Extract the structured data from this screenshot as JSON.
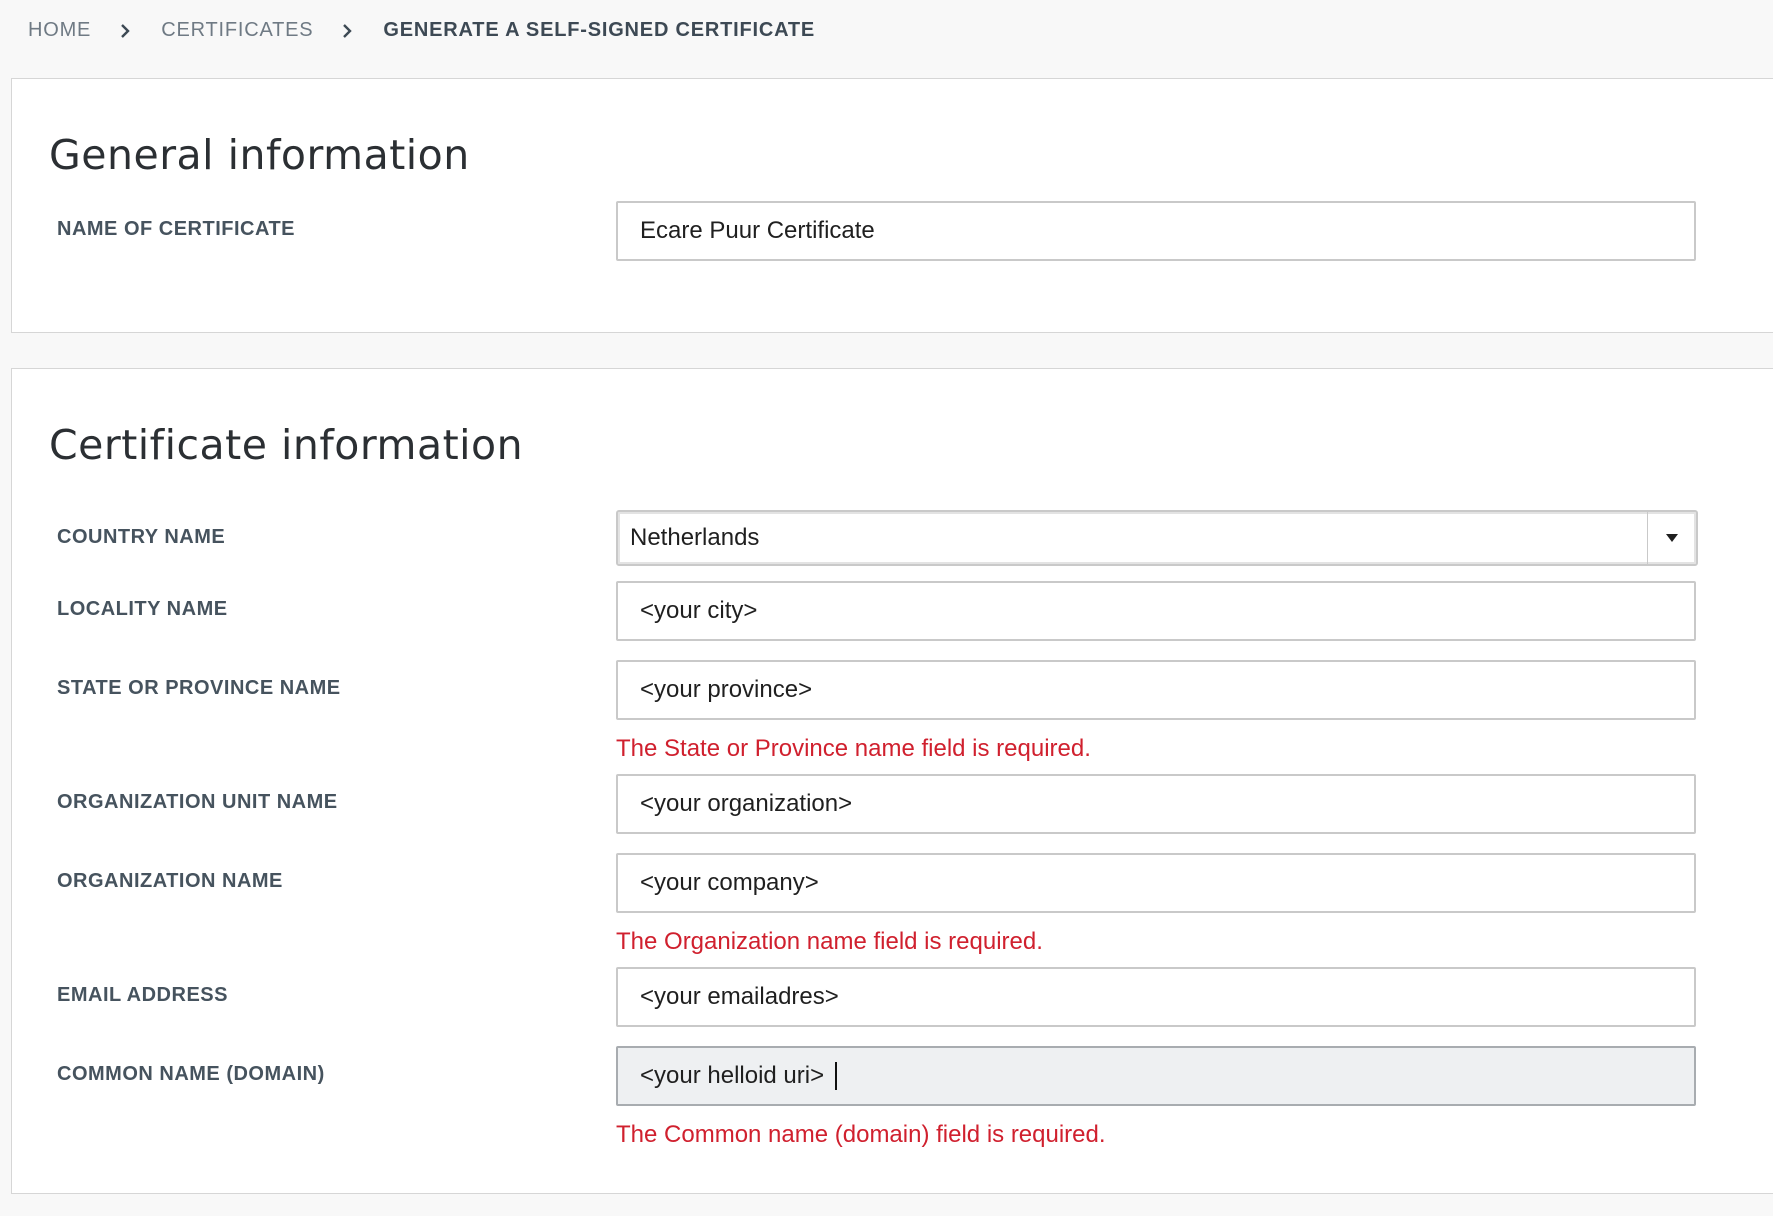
{
  "breadcrumb": {
    "home": "HOME",
    "certificates": "CERTIFICATES",
    "current": "GENERATE A SELF-SIGNED CERTIFICATE"
  },
  "general": {
    "title": "General information",
    "name_label": "NAME OF CERTIFICATE",
    "name_value": "Ecare Puur Certificate"
  },
  "cert": {
    "title": "Certificate information",
    "country_label": "COUNTRY NAME",
    "country_value": "Netherlands",
    "locality_label": "LOCALITY NAME",
    "locality_value": "<your city>",
    "state_label": "STATE OR PROVINCE NAME",
    "state_value": "<your province>",
    "state_error": "The State or Province name field is required.",
    "org_unit_label": "ORGANIZATION UNIT NAME",
    "org_unit_value": "<your organization>",
    "org_label": "ORGANIZATION NAME",
    "org_value": "<your company>",
    "org_error": "The Organization name field is required.",
    "email_label": "EMAIL ADDRESS",
    "email_value": "<your emailadres>",
    "common_label": "COMMON NAME (DOMAIN)",
    "common_value": "<your helloid uri>",
    "common_error": "The Common name (domain) field is required."
  },
  "colors": {
    "error": "#d0202e",
    "label": "#46535e",
    "page_bg": "#f8f8f8"
  }
}
